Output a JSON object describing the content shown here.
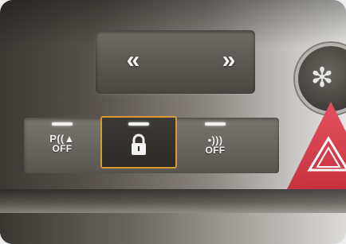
{
  "navigation": {
    "left_arrow": "«",
    "right_arrow": "»"
  },
  "buttons": {
    "park_assist": {
      "symbol": "P((▲",
      "label": "OFF",
      "led": "on"
    },
    "lock": {
      "led": "on",
      "highlighted": true
    },
    "sound": {
      "symbol": "•)))",
      "label": "OFF",
      "led": "on"
    }
  },
  "fan": {
    "icon": "fan-icon",
    "glyph": "✻"
  },
  "hazard": {
    "icon": "hazard-triangle-icon"
  },
  "colors": {
    "highlight_border": "#d79a34",
    "hazard_red": "#d7404e",
    "led": "#f2f2f2"
  }
}
